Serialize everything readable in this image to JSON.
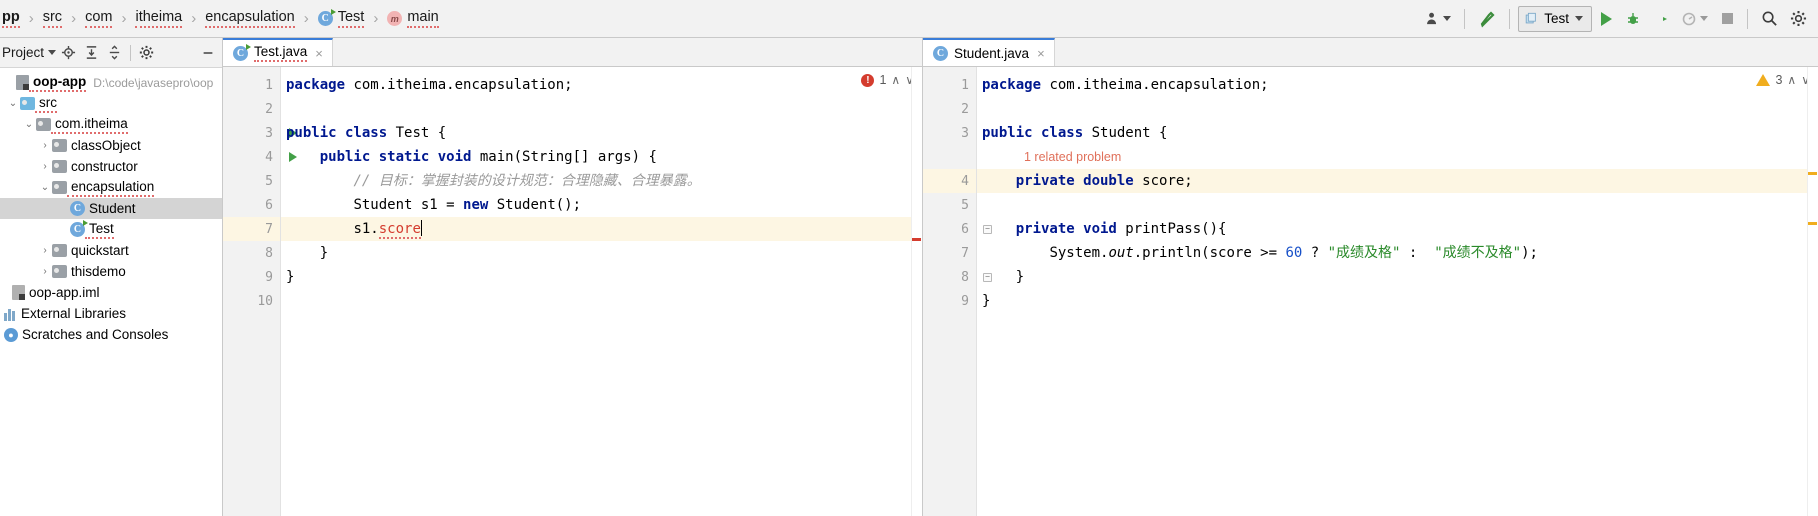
{
  "breadcrumb": [
    {
      "label": "pp",
      "icon": "none",
      "bold": true
    },
    {
      "label": "src",
      "icon": "none",
      "bold": false
    },
    {
      "label": "com",
      "icon": "none",
      "bold": false
    },
    {
      "label": "itheima",
      "icon": "none",
      "bold": false
    },
    {
      "label": "encapsulation",
      "icon": "none",
      "bold": false
    },
    {
      "label": "Test",
      "icon": "class-runnable-icon",
      "bold": false
    },
    {
      "label": "main",
      "icon": "method-icon",
      "bold": false
    }
  ],
  "toolbar": {
    "account_icon": "user-icon",
    "build_icon": "hammer-icon",
    "run_config": "Test",
    "run_icon": "run-icon",
    "debug_icon": "debug-icon",
    "run_coverage_icon": "run-with-coverage-icon",
    "profiler_icon": "profiler-icon",
    "stop_icon": "stop-icon",
    "search_icon": "search-icon",
    "settings_icon": "gear-icon"
  },
  "project_panel": {
    "title": "Project",
    "header_buttons": [
      "locate-icon",
      "expand-all-icon",
      "collapse-all-icon",
      "gear-icon"
    ],
    "tree": [
      {
        "label": "oop-app",
        "path": "D:\\code\\javasepro\\oop",
        "indent": 0,
        "arrow": "",
        "icon": "module-icon",
        "bold": true,
        "selected": false
      },
      {
        "label": "src",
        "path": "",
        "indent": 1,
        "arrow": "v",
        "icon": "source-folder-icon",
        "bold": false,
        "selected": false
      },
      {
        "label": "com.itheima",
        "path": "",
        "indent": 2,
        "arrow": "v",
        "icon": "package-icon",
        "bold": false,
        "selected": false
      },
      {
        "label": "classObject",
        "path": "",
        "indent": 3,
        "arrow": ">",
        "icon": "package-icon",
        "bold": false,
        "selected": false
      },
      {
        "label": "constructor",
        "path": "",
        "indent": 3,
        "arrow": ">",
        "icon": "package-icon",
        "bold": false,
        "selected": false
      },
      {
        "label": "encapsulation",
        "path": "",
        "indent": 3,
        "arrow": "v",
        "icon": "package-icon",
        "bold": false,
        "selected": false
      },
      {
        "label": "Student",
        "path": "",
        "indent": 4,
        "arrow": "",
        "icon": "class-icon",
        "bold": false,
        "selected": true
      },
      {
        "label": "Test",
        "path": "",
        "indent": 4,
        "arrow": "",
        "icon": "class-runnable-icon",
        "bold": false,
        "selected": false
      },
      {
        "label": "quickstart",
        "path": "",
        "indent": 3,
        "arrow": ">",
        "icon": "package-icon",
        "bold": false,
        "selected": false
      },
      {
        "label": "thisdemo",
        "path": "",
        "indent": 3,
        "arrow": ">",
        "icon": "package-icon",
        "bold": false,
        "selected": false
      },
      {
        "label": "oop-app.iml",
        "path": "",
        "indent": 1,
        "arrow": "",
        "icon": "iml-icon",
        "bold": false,
        "selected": false
      },
      {
        "label": "External Libraries",
        "path": "",
        "indent": 0,
        "arrow": "",
        "icon": "library-icon",
        "bold": false,
        "selected": false
      },
      {
        "label": "Scratches and Consoles",
        "path": "",
        "indent": 0,
        "arrow": "",
        "icon": "scratches-icon",
        "bold": false,
        "selected": false
      }
    ]
  },
  "left_editor": {
    "tab": {
      "label": "Test.java",
      "icon": "class-runnable-icon",
      "close": "×"
    },
    "status": {
      "error_count": "1",
      "up": "∧",
      "down": "∨"
    },
    "lines": [
      {
        "num": "1",
        "run": false,
        "fold": false,
        "hl": false
      },
      {
        "num": "2",
        "run": false,
        "fold": false,
        "hl": false
      },
      {
        "num": "3",
        "run": true,
        "fold": false,
        "hl": false
      },
      {
        "num": "4",
        "run": true,
        "fold": true,
        "hl": false
      },
      {
        "num": "5",
        "run": false,
        "fold": false,
        "hl": false
      },
      {
        "num": "6",
        "run": false,
        "fold": false,
        "hl": false
      },
      {
        "num": "7",
        "run": false,
        "fold": false,
        "hl": true
      },
      {
        "num": "8",
        "run": false,
        "fold": true,
        "hl": false
      },
      {
        "num": "9",
        "run": false,
        "fold": false,
        "hl": false
      },
      {
        "num": "10",
        "run": false,
        "fold": false,
        "hl": false
      }
    ],
    "code": {
      "l1_kw": "package",
      "l1_rest": " com.itheima.encapsulation;",
      "l3_kw": "public class",
      "l3_rest": " Test {",
      "l4_kw": "public static void",
      "l4_rest": " main(String[] args) {",
      "l5_comment": "// 目标：掌握封装的设计规范：合理隐藏、合理暴露。",
      "l6_pre": "Student s1 = ",
      "l6_kw": "new",
      "l6_post": " Student();",
      "l7_pre": "s1.",
      "l7_err": "score",
      "l8": "}",
      "l9": "}"
    }
  },
  "right_editor": {
    "tab": {
      "label": "Student.java",
      "icon": "class-icon",
      "close": "×"
    },
    "status": {
      "warning_count": "3",
      "up": "∧",
      "down": "∨"
    },
    "lines": [
      {
        "num": "1",
        "fold": false,
        "hl": false
      },
      {
        "num": "2",
        "fold": false,
        "hl": false
      },
      {
        "num": "3",
        "fold": false,
        "hl": false
      },
      {
        "num": "4",
        "fold": false,
        "hl": true
      },
      {
        "num": "5",
        "fold": false,
        "hl": false
      },
      {
        "num": "6",
        "fold": true,
        "hl": false
      },
      {
        "num": "7",
        "fold": false,
        "hl": false
      },
      {
        "num": "8",
        "fold": true,
        "hl": false
      },
      {
        "num": "9",
        "fold": false,
        "hl": false
      }
    ],
    "code": {
      "l1_kw": "package",
      "l1_rest": " com.itheima.encapsulation;",
      "l3_kw": "public class",
      "l3_rest": " Student {",
      "inlay_hint": "1 related problem",
      "l4_kw": "private double",
      "l4_rest": " score;",
      "l6_kw": "private void",
      "l6_rest": " printPass(){",
      "l7_pre": "System.",
      "l7_out": "out",
      "l7_mid": ".println(score >= ",
      "l7_num": "60",
      "l7_q": " ? ",
      "l7_s1": "\"成绩及格\"",
      "l7_colon": " :  ",
      "l7_s2": "\"成绩不及格\"",
      "l7_end": ");",
      "l8": "}",
      "l9": "}"
    }
  },
  "colors": {
    "keyword": "#00188f",
    "string": "#2a8a2a",
    "number": "#1750c8",
    "error": "#d43c2e",
    "comment": "#9a9a9a",
    "inlay": "#e0705a",
    "selection": "#d4d4d4",
    "caret_line": "#fdf6e3",
    "accent": "#3b7dd8"
  }
}
